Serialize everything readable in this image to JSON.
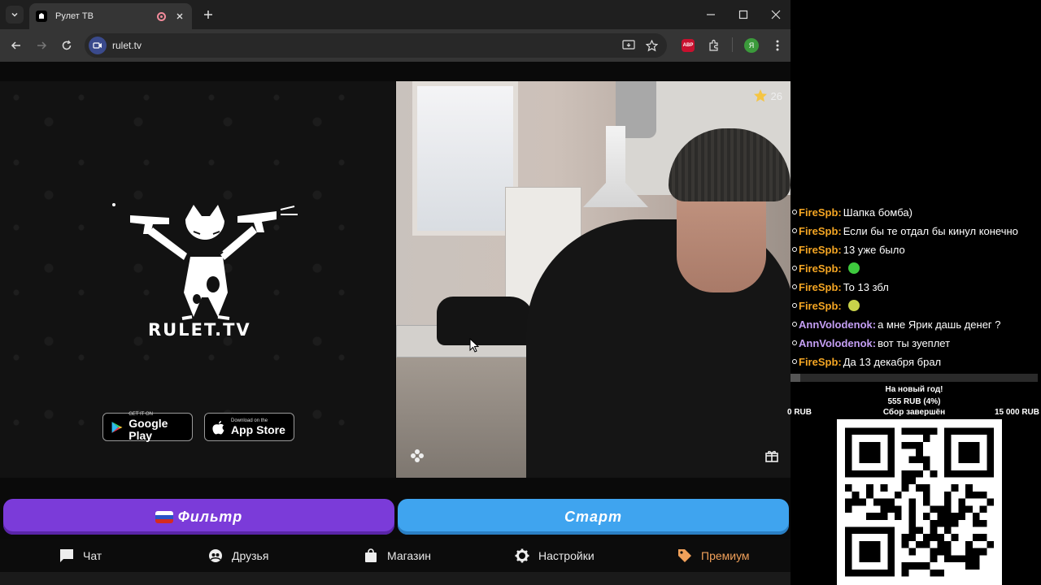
{
  "browser": {
    "tab_title": "Рулет ТВ",
    "url": "rulet.tv"
  },
  "page": {
    "logo_text": "RULET.TV",
    "stores": {
      "google_small": "GET IT ON",
      "google_big": "Google Play",
      "apple_small": "Download on the",
      "apple_big": "App Store"
    },
    "video": {
      "stars": "26"
    },
    "buttons": {
      "filter": "Фильтр",
      "start": "Старт"
    },
    "nav": [
      "Чат",
      "Друзья",
      "Магазин",
      "Настройки",
      "Премиум"
    ],
    "colors": {
      "filter": "#7b3bd9",
      "start": "#3fa4ef",
      "premium": "#f0a05a"
    }
  },
  "overlay": {
    "chat": [
      {
        "user": "FireSpb:",
        "text": "Шапка бомба)",
        "color": "#f5a623"
      },
      {
        "user": "FireSpb:",
        "text": "Если бы те отдал бы кинул конечно",
        "color": "#f5a623"
      },
      {
        "user": "FireSpb:",
        "text": "13 уже было",
        "color": "#f5a623"
      },
      {
        "user": "FireSpb:",
        "text": "",
        "color": "#f5a623",
        "emote": "#3ec93e"
      },
      {
        "user": "FireSpb:",
        "text": "То 13 збл",
        "color": "#f5a623"
      },
      {
        "user": "FireSpb:",
        "text": "",
        "color": "#f5a623",
        "emote": "#c8d24a"
      },
      {
        "user": "AnnVolodenok:",
        "text": "а мне Ярик дашь денег ?",
        "color": "#c59ff5"
      },
      {
        "user": "AnnVolodenok:",
        "text": "вот ты зуеплет",
        "color": "#c59ff5"
      },
      {
        "user": "FireSpb:",
        "text": "Да 13 декабря брал",
        "color": "#f5a623"
      }
    ],
    "goal": {
      "title": "На новый год!",
      "amount": "555 RUB (4%)",
      "progress": 0.04,
      "min": "0 RUB",
      "status": "Сбор завершён",
      "max": "15 000 RUB"
    }
  }
}
